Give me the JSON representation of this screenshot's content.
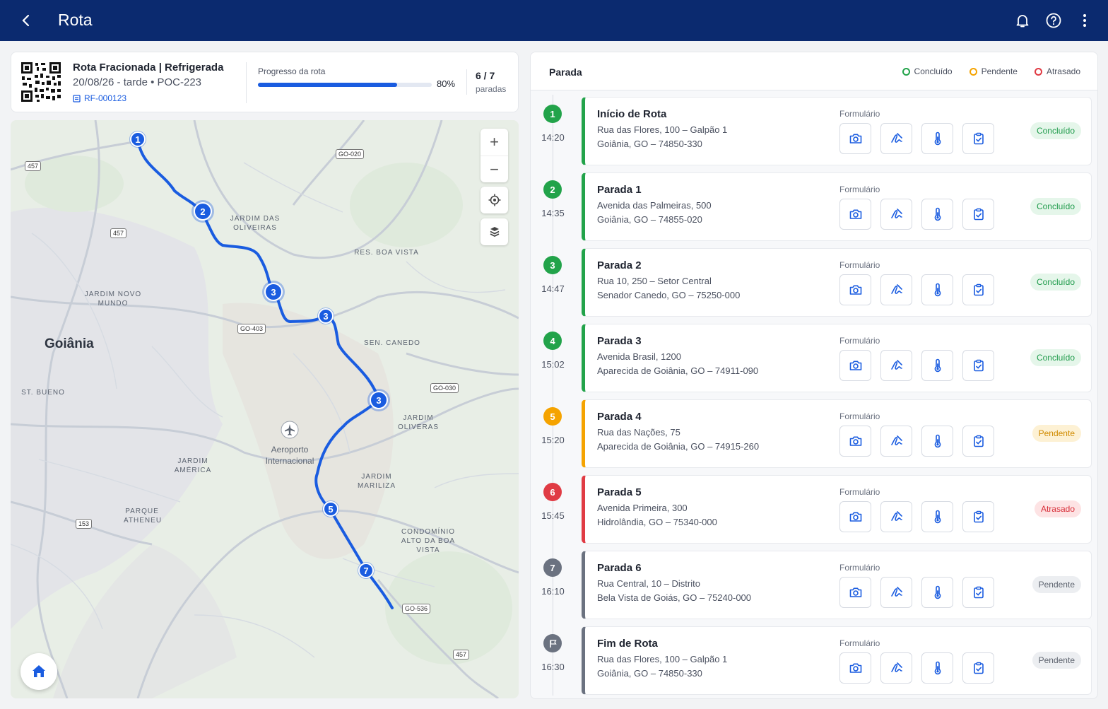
{
  "appbar": {
    "title": "Rota"
  },
  "summary": {
    "title": "Rota Fracionada | Refrigerada",
    "subtitle": "20/08/26 - tarde  •  POC-223",
    "code": "RF-000123",
    "progress_label": "Progresso da rota",
    "progress_value": 0.8,
    "progress_pct": "80%",
    "count": "6 / 7",
    "count_label": "paradas"
  },
  "map": {
    "city": "Goiânia",
    "places": [
      "JARDIM DAS OLIVEIRAS",
      "RES. BOA VISTA",
      "JARDIM NOVO MUNDO",
      "SEN. CANEDO",
      "ST. BUENO",
      "JARDIM OLIVERAS",
      "JARDIM MARILIZA",
      "JARDIM AMÉRICA",
      "PARQUE ATHENEU",
      "CONDOMÍNIO ALTO DA BOA VISTA"
    ],
    "airport": "Aeroporto Internacional",
    "roads": [
      "457",
      "GO-020",
      "457",
      "GO-403",
      "GO-030",
      "153",
      "GO-536",
      "457"
    ],
    "markers": [
      "1",
      "2",
      "3",
      "3",
      "3",
      "5",
      "7"
    ],
    "zoom_in": "+",
    "zoom_out": "−"
  },
  "panel": {
    "title": "Parada",
    "legend": [
      {
        "label": "Concluído",
        "color": "#22a34a"
      },
      {
        "label": "Pendente",
        "color": "#f5a300"
      },
      {
        "label": "Atrasado",
        "color": "#e03b44"
      }
    ],
    "form_label": "Formulário",
    "stops": [
      {
        "num": "1",
        "time": "14:20",
        "name": "Início de Rota",
        "addr1": "Rua das Flores, 100 – Galpão 1",
        "addr2": "Goiânia, GO – 74850-330",
        "status": "Concluído",
        "kind": "ok"
      },
      {
        "num": "2",
        "time": "14:35",
        "name": "Parada 1",
        "addr1": "Avenida das Palmeiras, 500",
        "addr2": "Goiânia, GO – 74855-020",
        "status": "Concluído",
        "kind": "ok"
      },
      {
        "num": "3",
        "time": "14:47",
        "name": "Parada 2",
        "addr1": "Rua 10, 250 – Setor Central",
        "addr2": "Senador Canedo, GO – 75250-000",
        "status": "Concluído",
        "kind": "ok"
      },
      {
        "num": "4",
        "time": "15:02",
        "name": "Parada 3",
        "addr1": "Avenida Brasil, 1200",
        "addr2": "Aparecida de Goiânia, GO – 74911-090",
        "status": "Concluído",
        "kind": "ok"
      },
      {
        "num": "5",
        "time": "15:20",
        "name": "Parada 4",
        "addr1": "Rua das Nações, 75",
        "addr2": "Aparecida de Goiânia, GO – 74915-260",
        "status": "Pendente",
        "kind": "pend"
      },
      {
        "num": "6",
        "time": "15:45",
        "name": "Parada 5",
        "addr1": "Avenida Primeira, 300",
        "addr2": "Hidrolândia, GO – 75340-000",
        "status": "Atrasado",
        "kind": "late"
      },
      {
        "num": "7",
        "time": "16:10",
        "name": "Parada 6",
        "addr1": "Rua Central, 10 – Distrito",
        "addr2": "Bela Vista de Goiás, GO – 75240-000",
        "status": "Pendente",
        "kind": "grey"
      },
      {
        "num": "",
        "time": "16:30",
        "name": "Fim de Rota",
        "addr1": "Rua das Flores, 100 – Galpão 1",
        "addr2": "Goiânia, GO – 74850-330",
        "status": "Pendente",
        "kind": "grey",
        "flag": true
      }
    ]
  },
  "colors": {
    "primary": "#0b2a6f",
    "accent": "#1a5ce0",
    "ok": "#22a34a",
    "pending": "#f5a300",
    "late": "#e03b44",
    "grey": "#6b7280"
  }
}
